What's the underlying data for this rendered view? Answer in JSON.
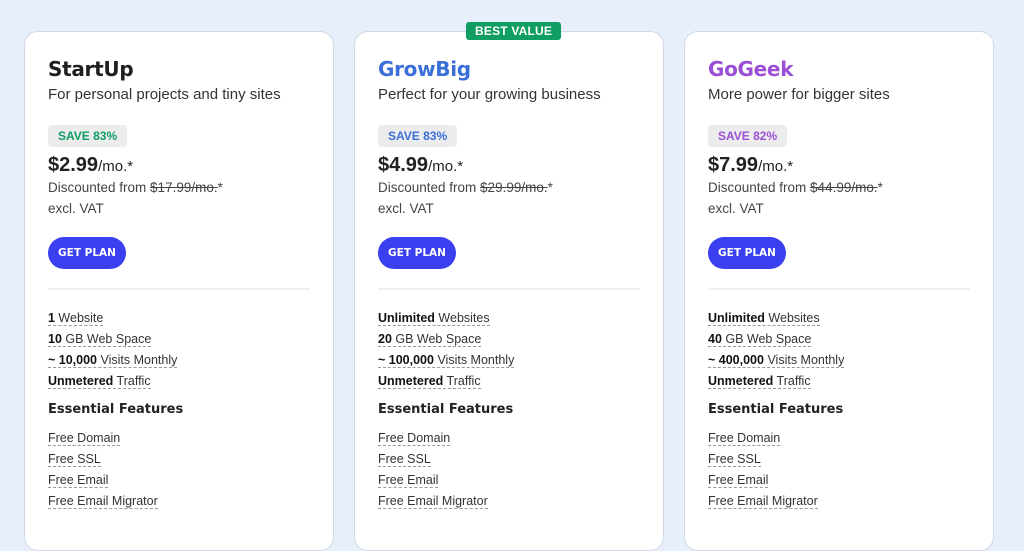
{
  "plans": [
    {
      "name": "StartUp",
      "name_color": "#1f1f1f",
      "subtitle": "For personal projects and tiny sites",
      "save": "SAVE 83%",
      "save_color": "#0f9d63",
      "price": "$2.99",
      "price_unit": "/mo.*",
      "discount_prefix": "Discounted from ",
      "original_price": "$17.99/mo.",
      "discount_suffix": "*",
      "vat": "excl. VAT",
      "cta": "GET PLAN",
      "specs": [
        {
          "bold": "1",
          "text": " Website"
        },
        {
          "bold": "10",
          "text": " GB Web Space"
        },
        {
          "bold": "~ 10,000",
          "text": " Visits Monthly"
        },
        {
          "bold": "Unmetered",
          "text": " Traffic"
        }
      ],
      "features_title": "Essential Features",
      "features": [
        "Free Domain",
        "Free SSL",
        "Free Email",
        "Free Email Migrator"
      ]
    },
    {
      "badge": "BEST VALUE",
      "name": "GrowBig",
      "name_color": "#3b6fd8",
      "subtitle": "Perfect for your growing business",
      "save": "SAVE 83%",
      "save_color": "#3b6fd8",
      "price": "$4.99",
      "price_unit": "/mo.*",
      "discount_prefix": "Discounted from ",
      "original_price": "$29.99/mo.",
      "discount_suffix": "*",
      "vat": "excl. VAT",
      "cta": "GET PLAN",
      "specs": [
        {
          "bold": "Unlimited",
          "text": " Websites"
        },
        {
          "bold": "20",
          "text": " GB Web Space"
        },
        {
          "bold": "~ 100,000",
          "text": " Visits Monthly"
        },
        {
          "bold": "Unmetered",
          "text": " Traffic"
        }
      ],
      "features_title": "Essential Features",
      "features": [
        "Free Domain",
        "Free SSL",
        "Free Email",
        "Free Email Migrator"
      ]
    },
    {
      "name": "GoGeek",
      "name_color": "#9b4fd6",
      "subtitle": "More power for bigger sites",
      "save": "SAVE 82%",
      "save_color": "#9b4fd6",
      "price": "$7.99",
      "price_unit": "/mo.*",
      "discount_prefix": "Discounted from ",
      "original_price": "$44.99/mo.",
      "discount_suffix": "*",
      "vat": "excl. VAT",
      "cta": "GET PLAN",
      "specs": [
        {
          "bold": "Unlimited",
          "text": " Websites"
        },
        {
          "bold": "40",
          "text": " GB Web Space"
        },
        {
          "bold": "~ 400,000",
          "text": " Visits Monthly"
        },
        {
          "bold": "Unmetered",
          "text": " Traffic"
        }
      ],
      "features_title": "Essential Features",
      "features": [
        "Free Domain",
        "Free SSL",
        "Free Email",
        "Free Email Migrator"
      ]
    }
  ],
  "colors": {
    "background": "#e6effa",
    "button": "#3a3ff0",
    "best_value": "#0f9d63"
  }
}
